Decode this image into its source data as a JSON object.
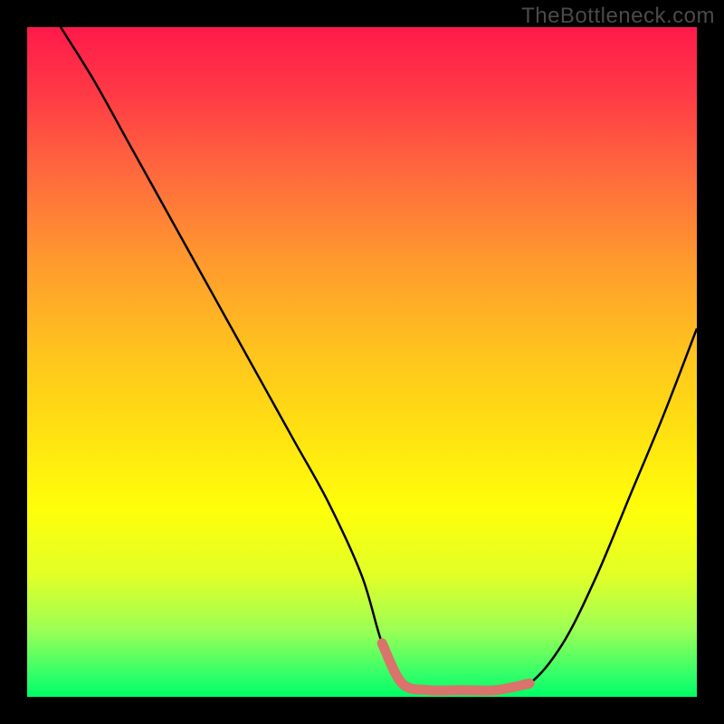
{
  "watermark": "TheBottleneck.com",
  "chart_data": {
    "type": "line",
    "title": "",
    "xlabel": "",
    "ylabel": "",
    "xlim": [
      0,
      100
    ],
    "ylim": [
      0,
      100
    ],
    "grid": false,
    "legend": false,
    "gradient_stops": [
      {
        "pct": 0,
        "color": "#ff1a4a"
      },
      {
        "pct": 10,
        "color": "#ff3a46"
      },
      {
        "pct": 22,
        "color": "#ff6a3d"
      },
      {
        "pct": 35,
        "color": "#ff9a2e"
      },
      {
        "pct": 48,
        "color": "#ffc21e"
      },
      {
        "pct": 60,
        "color": "#ffe012"
      },
      {
        "pct": 72,
        "color": "#ffff0a"
      },
      {
        "pct": 82,
        "color": "#e0ff28"
      },
      {
        "pct": 90,
        "color": "#9cff55"
      },
      {
        "pct": 97,
        "color": "#2dff6a"
      },
      {
        "pct": 100,
        "color": "#00ff66"
      }
    ],
    "series": [
      {
        "name": "curve",
        "color": "#000000",
        "x": [
          5,
          10,
          15,
          20,
          25,
          30,
          35,
          40,
          45,
          50,
          53,
          56,
          60,
          65,
          70,
          75,
          80,
          85,
          90,
          95,
          100
        ],
        "y": [
          100,
          92,
          83,
          74,
          65,
          56,
          47,
          38,
          29,
          18,
          8,
          2,
          1,
          1,
          1,
          2,
          8,
          18,
          30,
          42,
          55
        ]
      },
      {
        "name": "highlight",
        "color": "#d9736b",
        "x": [
          53,
          56,
          60,
          65,
          70,
          75
        ],
        "y": [
          8,
          2,
          1,
          1,
          1,
          2
        ]
      }
    ]
  }
}
